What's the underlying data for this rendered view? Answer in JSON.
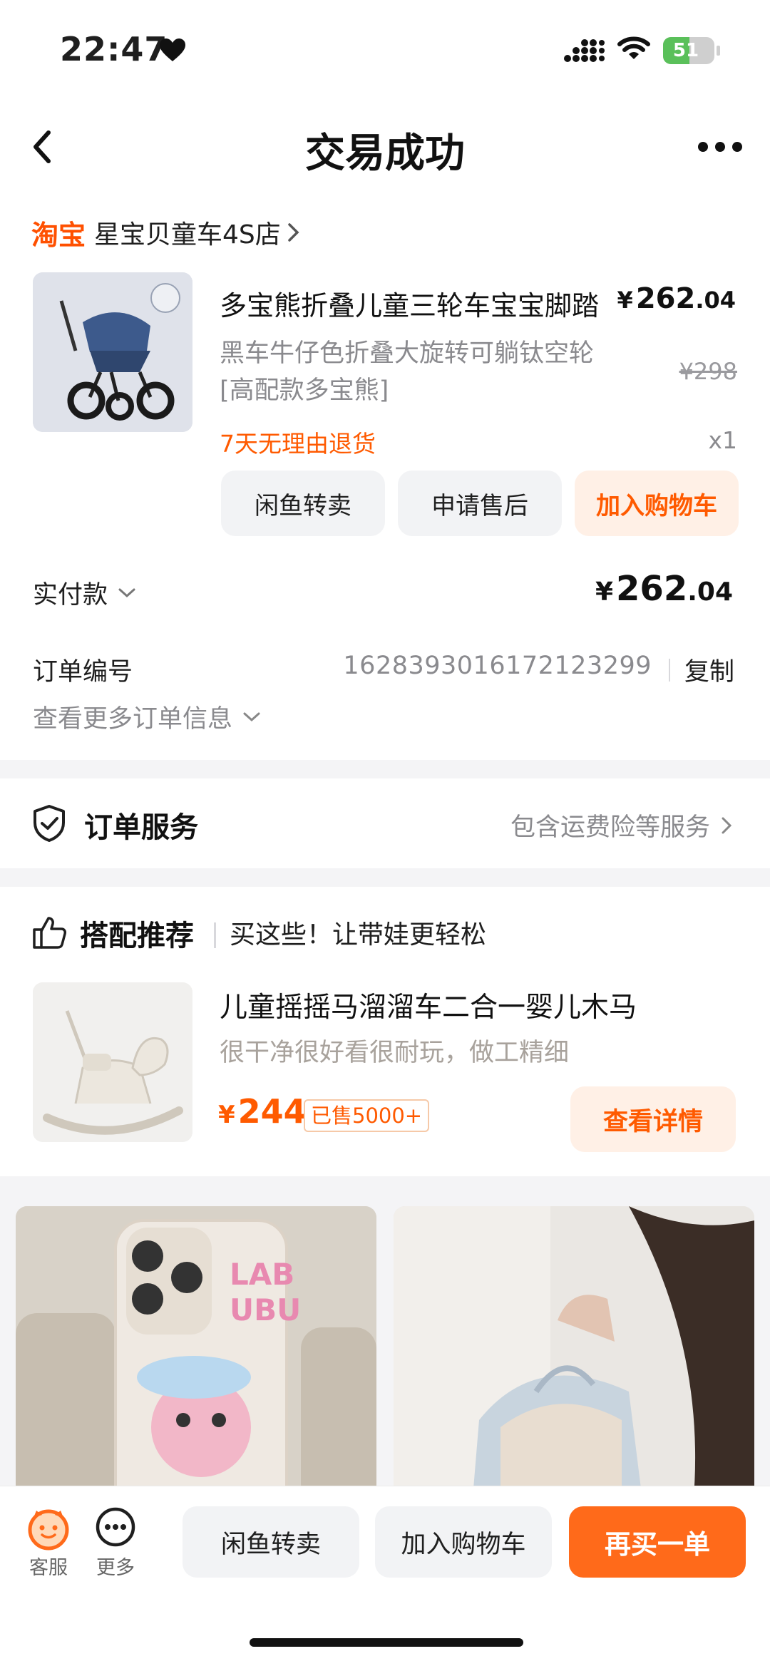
{
  "status_bar": {
    "time": "22:47",
    "battery": "51",
    "battery_level": 0.51
  },
  "nav": {
    "title": "交易成功"
  },
  "store": {
    "brand": "淘宝",
    "name": "星宝贝童车4S店"
  },
  "product": {
    "title": "多宝熊折叠儿童三轮车宝宝脚踏",
    "price_currency": "¥",
    "price_int": "262",
    "price_dec": ".04",
    "spec_line1": "黑车牛仔色折叠大旋转可躺钛空轮",
    "spec_line2": "[高配款多宝熊]",
    "original_price": "¥298",
    "return_policy": "7天无理由退货",
    "quantity": "x1",
    "buttons": {
      "resell": "闲鱼转卖",
      "after_sale": "申请售后",
      "add_cart": "加入购物车"
    }
  },
  "payment": {
    "label": "实付款",
    "currency": "¥",
    "amount_int": "262",
    "amount_dec": ".04"
  },
  "order": {
    "number_label": "订单编号",
    "number": "1628393016172123299",
    "copy_label": "复制",
    "more_info": "查看更多订单信息"
  },
  "service": {
    "title": "订单服务",
    "desc": "包含运费险等服务"
  },
  "recommend": {
    "title": "搭配推荐",
    "subtitle": "买这些！让带娃更轻松",
    "item": {
      "name": "儿童摇摇马溜溜车二合一婴儿木马",
      "desc": "很干净很好看很耐玩，做工精细",
      "currency": "¥",
      "price": "244",
      "sold": "已售5000+",
      "button": "查看详情"
    }
  },
  "bottom_bar": {
    "service_label": "客服",
    "more_label": "更多",
    "resell": "闲鱼转卖",
    "add_cart": "加入购物车",
    "buy_again": "再买一单"
  },
  "colors": {
    "accent": "#ff5000",
    "accent_button": "#ff6a1a",
    "accent_soft_bg": "#fff0e6"
  }
}
